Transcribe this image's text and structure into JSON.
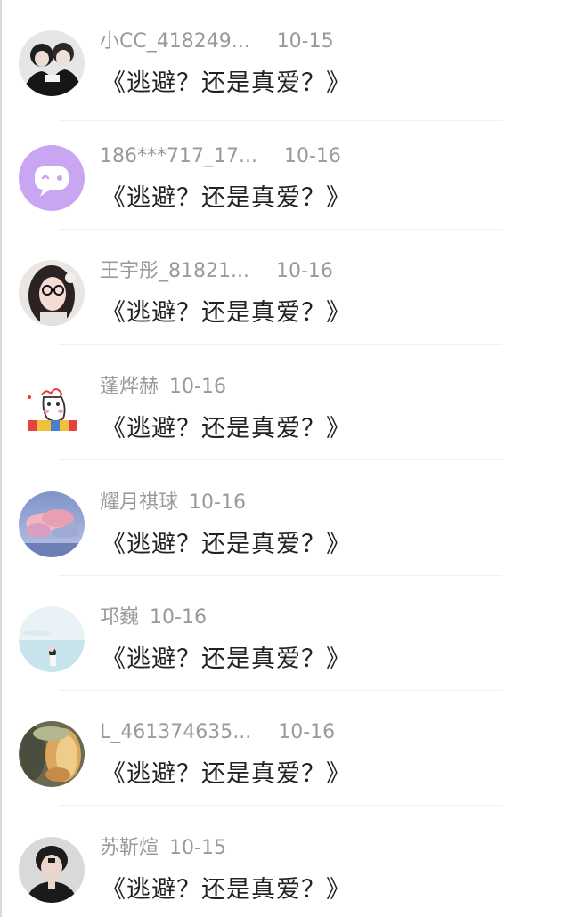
{
  "comments": [
    {
      "username": "186***717_17...",
      "date": "10-16",
      "content": "《逃避？还是真爱？》",
      "avatar": "purple-chat-bubble-icon"
    },
    {
      "username": "王宇彤_81821...",
      "date": "10-16",
      "content": "《逃避？还是真爱？》",
      "avatar": "girl-with-glasses-avatar"
    },
    {
      "username": "蓬烨赫",
      "date": "10-16",
      "content": "《逃避？还是真爱？》",
      "avatar": "cartoon-character-avatar"
    },
    {
      "username": "耀月祺球",
      "date": "10-16",
      "content": "《逃避？还是真爱？》",
      "avatar": "pink-cloud-sky-avatar"
    },
    {
      "username": "邛巍",
      "date": "10-16",
      "content": "《逃避？还是真爱？》",
      "avatar": "girl-by-sea-avatar"
    },
    {
      "username": "L_461374635...",
      "date": "10-16",
      "content": "《逃避？还是真爱？》",
      "avatar": "golden-hair-sunset-avatar"
    },
    {
      "username": "苏靳煊",
      "date": "10-15",
      "content": "《逃避？还是真爱？》",
      "avatar": "boy-portrait-avatar"
    },
    {
      "username": "小CC_418249...",
      "date": "10-15",
      "content": "《逃避？还是真爱？》",
      "avatar": "couple-photo-avatar"
    }
  ],
  "colors": {
    "username": "#9a9a9a",
    "content": "#222222",
    "divider": "#f0f0f0",
    "avatar_purple": "#c9a6f2"
  }
}
